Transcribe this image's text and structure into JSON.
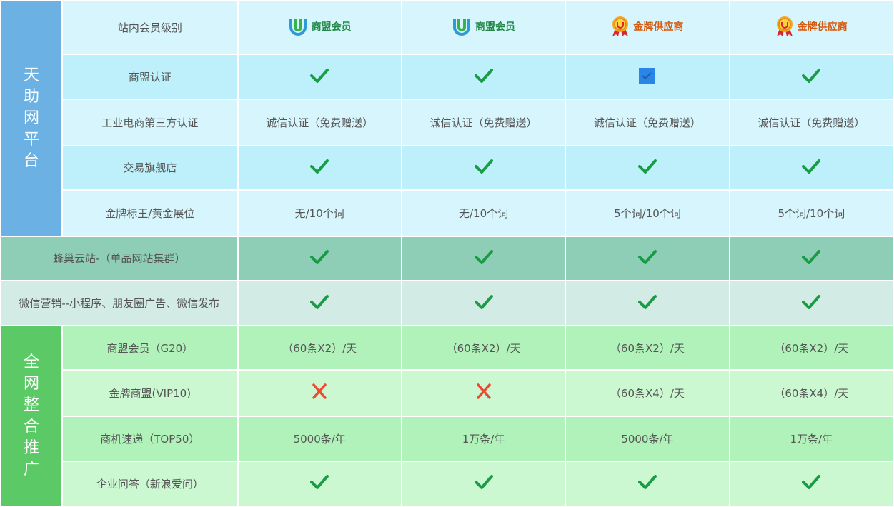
{
  "header": {
    "label": "站内会员级别",
    "plans": [
      {
        "name": "商盟会员",
        "icon": "shangmeng-logo-icon"
      },
      {
        "name": "商盟会员",
        "icon": "shangmeng-logo-icon"
      },
      {
        "name": "金牌供应商",
        "icon": "gold-medal-icon"
      },
      {
        "name": "金牌供应商",
        "icon": "gold-medal-icon"
      }
    ]
  },
  "groups": [
    {
      "label": "天助网平台",
      "chars": [
        "天",
        "助",
        "网",
        "平",
        "台"
      ]
    },
    {
      "label": "全网整合推广",
      "chars": [
        "全",
        "网",
        "整",
        "合",
        "推",
        "广"
      ]
    }
  ],
  "rows": [
    {
      "label": "商盟认证",
      "cells": [
        "check",
        "check",
        "checkbox-checked",
        "check"
      ]
    },
    {
      "label": "工业电商第三方认证",
      "cells": [
        "诚信认证（免费赠送）",
        "诚信认证（免费赠送）",
        "诚信认证（免费赠送）",
        "诚信认证（免费赠送）"
      ]
    },
    {
      "label": "交易旗舰店",
      "cells": [
        "check",
        "check",
        "check",
        "check"
      ]
    },
    {
      "label": "金牌标王/黄金展位",
      "cells": [
        "无/10个词",
        "无/10个词",
        "5个词/10个词",
        "5个词/10个词"
      ]
    },
    {
      "label": "蜂巢云站-（单品网站集群）",
      "cells": [
        "check",
        "check",
        "check",
        "check"
      ]
    },
    {
      "label": "微信营销--小程序、朋友圈广告、微信发布",
      "cells": [
        "check",
        "check",
        "check",
        "check"
      ]
    },
    {
      "label": "商盟会员（G20）",
      "cells": [
        "（60条X2）/天",
        "（60条X2）/天",
        "（60条X2）/天",
        "（60条X2）/天"
      ]
    },
    {
      "label": "金牌商盟(VIP10)",
      "cells": [
        "cross",
        "cross",
        "（60条X4）/天",
        "（60条X4）/天"
      ]
    },
    {
      "label": "商机速递（TOP50）",
      "cells": [
        "5000条/年",
        "1万条/年",
        "5000条/年",
        "1万条/年"
      ]
    },
    {
      "label": "企业问答（新浪爱问）",
      "cells": [
        "check",
        "check",
        "check",
        "check"
      ]
    }
  ],
  "colors": {
    "check": "#1a9c47",
    "cross": "#ea4c33",
    "checkbox": "#2a86e6"
  }
}
